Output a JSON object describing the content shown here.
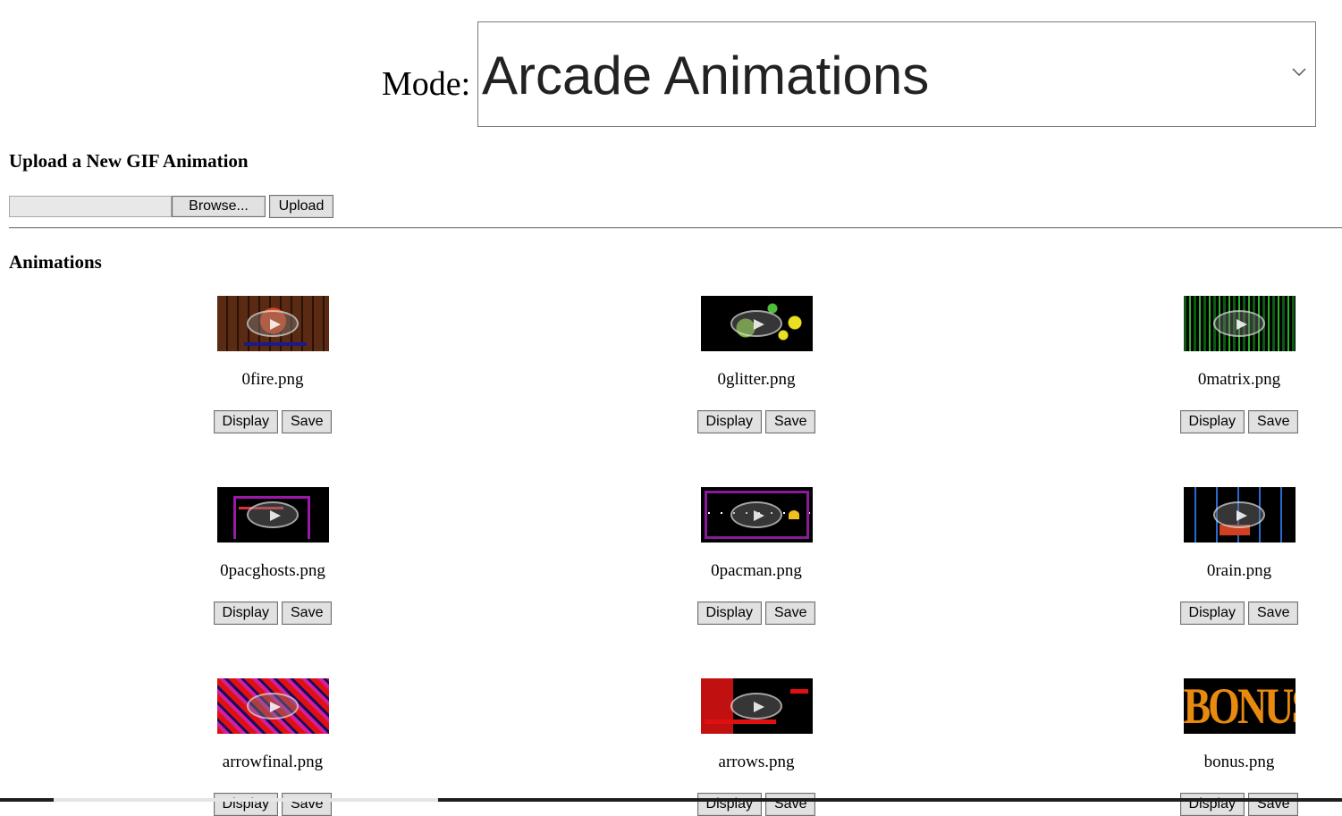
{
  "mode": {
    "label": "Mode:",
    "selected": "Arcade Animations"
  },
  "upload": {
    "title": "Upload a New GIF Animation",
    "browse_label": "Browse...",
    "upload_label": "Upload"
  },
  "animations": {
    "title": "Animations",
    "display_label": "Display",
    "save_label": "Save",
    "items": [
      {
        "name": "0fire.png"
      },
      {
        "name": "0glitter.png"
      },
      {
        "name": "0matrix.png"
      },
      {
        "name": "0pacghosts.png"
      },
      {
        "name": "0pacman.png"
      },
      {
        "name": "0rain.png"
      },
      {
        "name": "arrowfinal.png"
      },
      {
        "name": "arrows.png"
      },
      {
        "name": "bonus.png",
        "thumb_text": "BONUS"
      }
    ]
  }
}
